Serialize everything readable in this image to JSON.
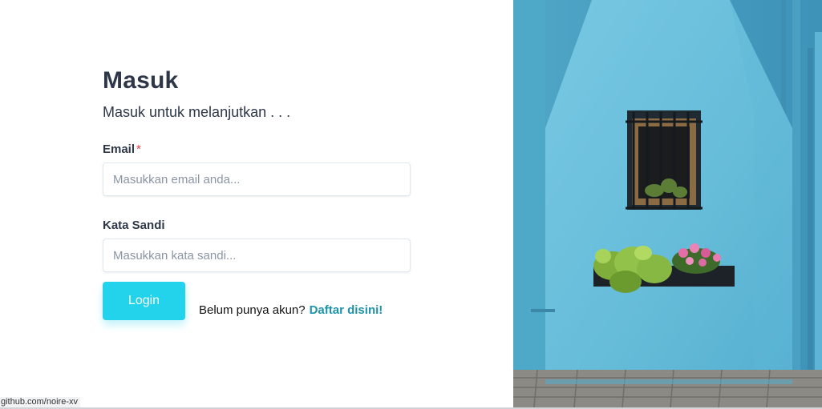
{
  "login": {
    "title": "Masuk",
    "subtitle": "Masuk untuk melanjutkan . . .",
    "email_label": "Email",
    "required_mark": "*",
    "email_placeholder": "Masukkan email anda...",
    "password_label": "Kata Sandi",
    "password_placeholder": "Masukkan kata sandi...",
    "login_button": "Login",
    "signup_prompt": "Belum punya akun?",
    "signup_link": "Daftar disini!"
  },
  "status_bar": {
    "url": "github.com/noire-xv"
  },
  "colors": {
    "accent": "#23d3ec",
    "link": "#1d93aa",
    "heading": "#2d3748",
    "required": "#e53e3e",
    "wall": "#68bedb"
  },
  "photo": {
    "subject": "turquoise-wall-window-flower-boxes"
  }
}
